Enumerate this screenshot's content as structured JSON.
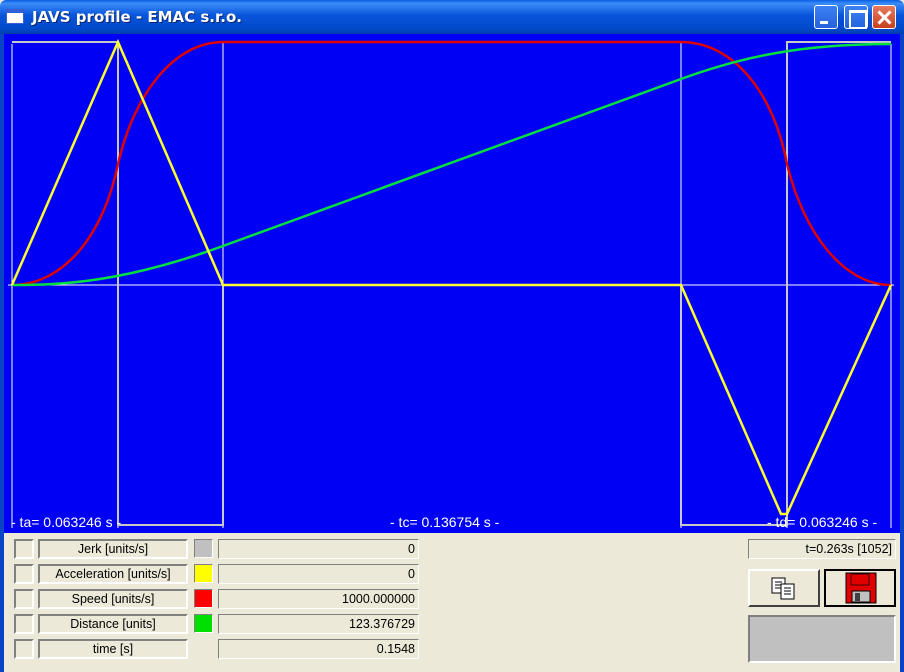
{
  "window": {
    "title": "JAVS profile - EMAC s.r.o."
  },
  "colors": {
    "plot_bg": "#0000F5",
    "jerk": "#C8C8C8",
    "acceleration": "#FFFF00",
    "speed": "#FF0000",
    "distance": "#00E000"
  },
  "plot": {
    "ta_label": "- ta= 0.063246 s -",
    "tc_label": "- tc= 0.136754 s -",
    "td_label": "- td= 0.063246 s -"
  },
  "rows": [
    {
      "label": "Jerk  [units/s]",
      "swatch": "#C0C0C0",
      "value": "0",
      "key": "jerk"
    },
    {
      "label": "Acceleration  [units/s]",
      "swatch": "#FFFF00",
      "value": "0",
      "key": "acceleration"
    },
    {
      "label": "Speed  [units/s]",
      "swatch": "#FF0000",
      "value": "1000.000000",
      "key": "speed"
    },
    {
      "label": "Distance  [units]",
      "swatch": "#00E000",
      "value": "123.376729",
      "key": "distance"
    },
    {
      "label": "time [s]",
      "swatch": "",
      "value": "0.1548",
      "key": "time"
    }
  ],
  "status": {
    "time_readout": "t=0.263s [1052]"
  },
  "icons": {
    "copy": "copy-clipboard-icon",
    "save": "floppy-disk-save-icon"
  }
}
